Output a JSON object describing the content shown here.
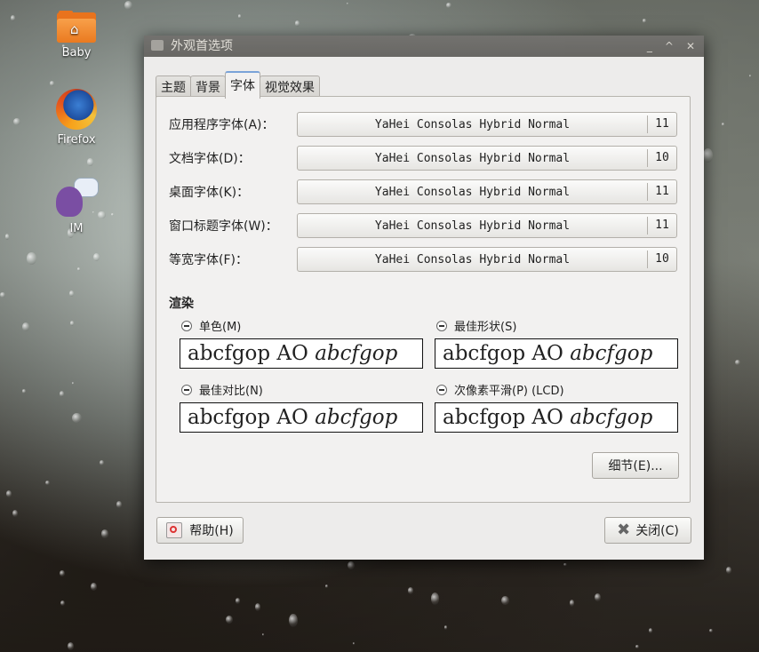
{
  "desktop": {
    "icons": [
      {
        "label": "Baby"
      },
      {
        "label": "Firefox"
      },
      {
        "label": "IM"
      }
    ]
  },
  "window": {
    "title": "外观首选项",
    "controls": {
      "minimize": "_",
      "maximize": "^",
      "close": "✕"
    }
  },
  "tabs": [
    {
      "label": "主题"
    },
    {
      "label": "背景"
    },
    {
      "label": "字体",
      "active": true
    },
    {
      "label": "视觉效果"
    }
  ],
  "fonts": [
    {
      "label": "应用程序字体(A)：",
      "name": "YaHei Consolas Hybrid Normal",
      "size": "11"
    },
    {
      "label": "文档字体(D)：",
      "name": "YaHei Consolas Hybrid Normal",
      "size": "10"
    },
    {
      "label": "桌面字体(K)：",
      "name": "YaHei Consolas Hybrid Normal",
      "size": "11"
    },
    {
      "label": "窗口标题字体(W)：",
      "name": "YaHei Consolas Hybrid Normal",
      "size": "11"
    },
    {
      "label": "等宽字体(F)：",
      "name": "YaHei Consolas Hybrid Normal",
      "size": "10"
    }
  ],
  "rendering": {
    "title": "渲染",
    "sample_regular": "abcfgop AO ",
    "sample_italic": "abcfgop",
    "options": [
      {
        "label": "单色(M)",
        "selected": false
      },
      {
        "label": "最佳形状(S)",
        "selected": false
      },
      {
        "label": "最佳对比(N)",
        "selected": false
      },
      {
        "label": "次像素平滑(P) (LCD)",
        "selected": false
      }
    ]
  },
  "buttons": {
    "details": "细节(E)...",
    "help": "帮助(H)",
    "close": "关闭(C)"
  }
}
